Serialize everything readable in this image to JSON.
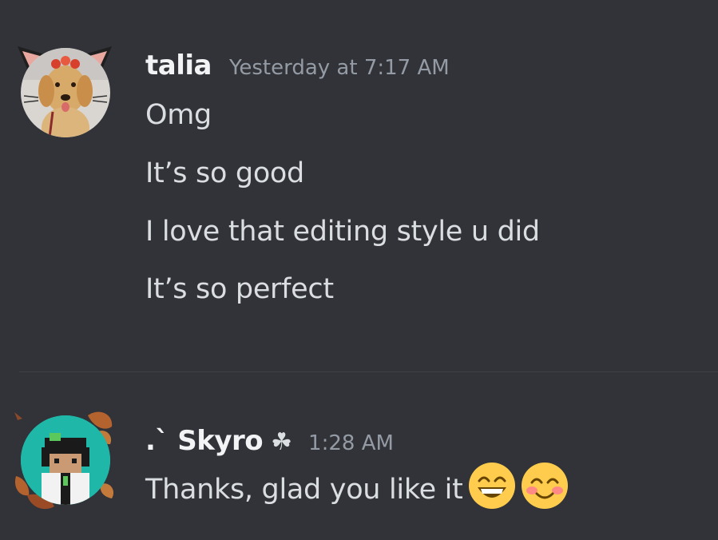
{
  "messages": [
    {
      "username": "talia",
      "timestamp": "Yesterday at 7:17 AM",
      "lines": [
        "Omg",
        "It’s so good",
        "I love that editing style u did",
        "It’s so perfect"
      ]
    },
    {
      "username": ".` Skyro",
      "username_suffix": "☘",
      "timestamp": "1:28 AM",
      "lines": [
        "Thanks, glad you like it"
      ],
      "emojis": [
        "grinning-face-emoji",
        "smiling-face-with-blush-emoji"
      ]
    }
  ],
  "colors": {
    "background": "#313338",
    "username": "#f2f3f5",
    "timestamp": "#949ba4",
    "message_text": "#dbdee1",
    "divider": "#3f4147"
  }
}
